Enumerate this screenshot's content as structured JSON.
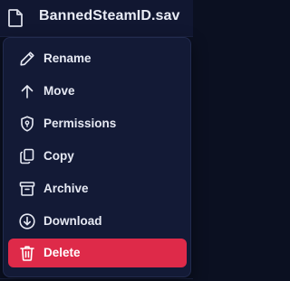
{
  "file": {
    "name": "BannedSteamID.sav",
    "icon": "file-icon"
  },
  "context_menu": {
    "items": [
      {
        "label": "Rename",
        "icon": "pencil-icon"
      },
      {
        "label": "Move",
        "icon": "arrow-up-icon"
      },
      {
        "label": "Permissions",
        "icon": "shield-lock-icon"
      },
      {
        "label": "Copy",
        "icon": "copy-icon"
      },
      {
        "label": "Archive",
        "icon": "archive-icon"
      },
      {
        "label": "Download",
        "icon": "download-icon"
      },
      {
        "label": "Delete",
        "icon": "trash-icon"
      }
    ]
  },
  "colors": {
    "background": "#0b1021",
    "menu_background": "#131a36",
    "text": "#e6e9f3",
    "danger": "#de2a49"
  }
}
